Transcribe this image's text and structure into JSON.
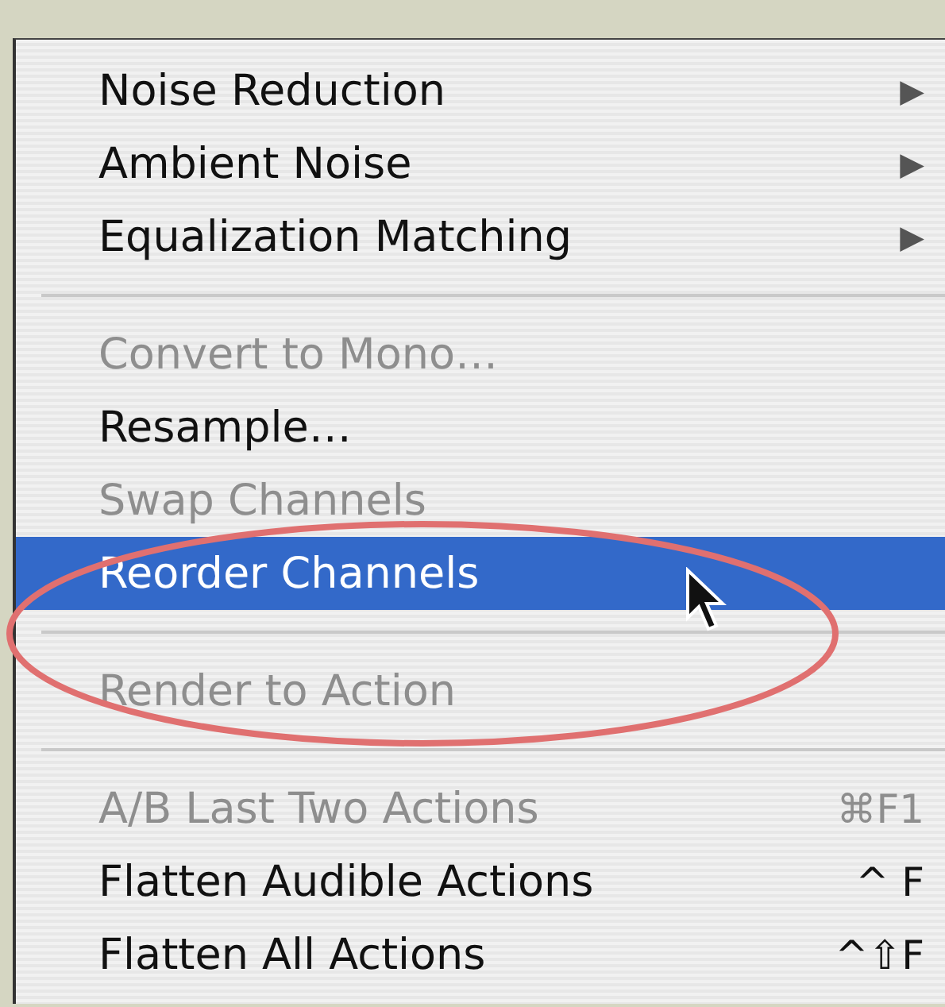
{
  "menu": {
    "items": [
      {
        "kind": "submenu",
        "label": "Noise Reduction",
        "submenu_arrow": "▶",
        "disabled": false,
        "selected": false
      },
      {
        "kind": "submenu",
        "label": "Ambient Noise",
        "submenu_arrow": "▶",
        "disabled": false,
        "selected": false
      },
      {
        "kind": "submenu",
        "label": "Equalization Matching",
        "submenu_arrow": "▶",
        "disabled": false,
        "selected": false
      },
      {
        "kind": "separator"
      },
      {
        "kind": "command",
        "label": "Convert to Mono…",
        "disabled": true,
        "selected": false
      },
      {
        "kind": "command",
        "label": "Resample…",
        "disabled": false,
        "selected": false
      },
      {
        "kind": "command",
        "label": "Swap Channels",
        "disabled": true,
        "selected": false
      },
      {
        "kind": "command",
        "label": "Reorder Channels",
        "disabled": false,
        "selected": true
      },
      {
        "kind": "separator"
      },
      {
        "kind": "command",
        "label": "Render to Action",
        "disabled": true,
        "selected": false
      },
      {
        "kind": "separator"
      },
      {
        "kind": "command",
        "label": "A/B Last Two Actions",
        "shortcut": "⌘F1",
        "disabled": true,
        "selected": false
      },
      {
        "kind": "command",
        "label": "Flatten Audible Actions",
        "shortcut": "^ F",
        "disabled": false,
        "selected": false
      },
      {
        "kind": "command",
        "label": "Flatten All Actions",
        "shortcut": "^⇧F",
        "disabled": false,
        "selected": false
      }
    ]
  }
}
